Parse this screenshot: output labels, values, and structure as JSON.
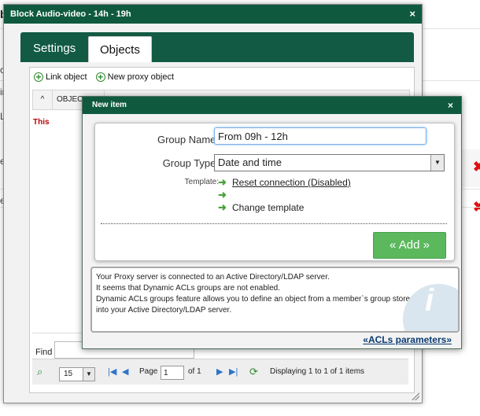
{
  "background": {
    "title_fragment": "bl",
    "fragments": [
      "on",
      "in",
      "L:",
      "eth",
      "eth"
    ]
  },
  "window": {
    "title": "Block Audio-video - 14h - 19h",
    "close_icon": "×",
    "tabs": [
      {
        "label": "Settings",
        "active": false
      },
      {
        "label": "Objects",
        "active": true
      }
    ]
  },
  "objects_panel": {
    "toolbar": {
      "link_object": "Link object",
      "new_proxy_object": "New proxy object"
    },
    "grid": {
      "columns": [
        "OBJEC"
      ],
      "rows": [
        {
          "text": "This"
        }
      ]
    },
    "find_label": "Find",
    "pager": {
      "page_size": "15",
      "page_label": "Page",
      "current_page": "1",
      "of_label": "of 1",
      "displaying": "Displaying 1 to 1 of 1 items"
    }
  },
  "dialog": {
    "title": "New item",
    "close_icon": "×",
    "group_name_label": "Group Name:",
    "group_name_value": "From 09h - 12h",
    "group_type_label": "Group Type:",
    "group_type_value": "Date and time",
    "template_label": "Template:",
    "template_items": [
      "Reset connection (Disabled)",
      "",
      "Change template"
    ],
    "add_button": "« Add »",
    "info_lines": [
      "Your Proxy server is connected to an Active Directory/LDAP server.",
      "It seems that Dynamic ACLs groups are not enabled.",
      "Dynamic ACLs groups feature allows you to define an object from a member`s group stored",
      "into your Active Directory/LDAP server."
    ],
    "acl_link": "«ACLs parameters»"
  },
  "colors": {
    "title_bar": "#0f5a3f",
    "add_button": "#5bb85d",
    "link": "#0a3a72",
    "error_x": "#e21010"
  }
}
